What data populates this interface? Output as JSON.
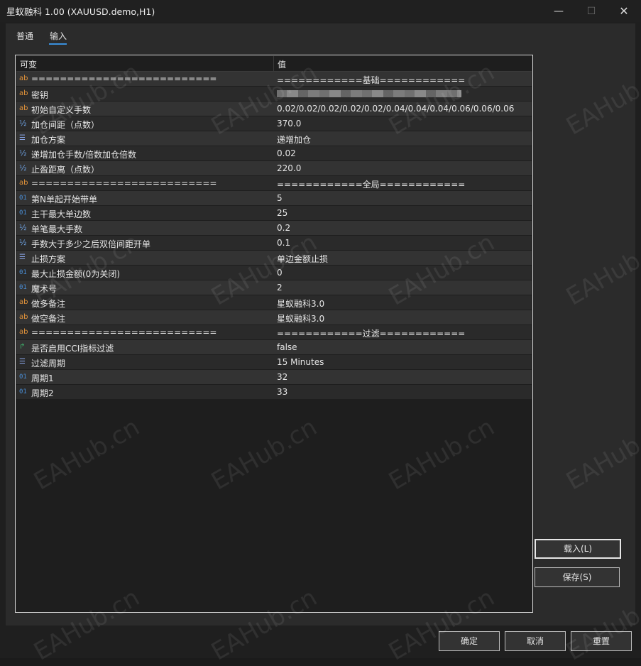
{
  "window": {
    "title": "星蚁融科 1.00 (XAUUSD.demo,H1)",
    "min_glyph": "—",
    "max_glyph": "☐",
    "close_glyph": "✕"
  },
  "tabs": [
    "普通",
    "输入"
  ],
  "grid": {
    "header_variable": "可变",
    "header_value": "值",
    "rows": [
      {
        "icon": "ab",
        "name": "==========================",
        "value": "============基础============"
      },
      {
        "icon": "ab",
        "name": "密钥",
        "value": "",
        "redacted": true
      },
      {
        "icon": "ab",
        "name": "初始自定义手数",
        "value": "0.02/0.02/0.02/0.02/0.02/0.04/0.04/0.04/0.06/0.06/0.06"
      },
      {
        "icon": "½",
        "name": "加仓间距（点数）",
        "value": "370.0"
      },
      {
        "icon": "enum",
        "name": "加仓方案",
        "value": "递增加仓"
      },
      {
        "icon": "½",
        "name": "递增加仓手数/倍数加仓倍数",
        "value": "0.02"
      },
      {
        "icon": "½",
        "name": "止盈距离（点数）",
        "value": "220.0"
      },
      {
        "icon": "ab",
        "name": "==========================",
        "value": "============全局============"
      },
      {
        "icon": "01",
        "name": "第N单起开始带单",
        "value": "5"
      },
      {
        "icon": "01",
        "name": "主干最大单边数",
        "value": "25"
      },
      {
        "icon": "½",
        "name": "单笔最大手数",
        "value": "0.2"
      },
      {
        "icon": "½",
        "name": "手数大于多少之后双倍间距开单",
        "value": "0.1"
      },
      {
        "icon": "enum",
        "name": "止损方案",
        "value": "单边金额止损"
      },
      {
        "icon": "01",
        "name": "最大止损金额(0为关闭)",
        "value": "0"
      },
      {
        "icon": "01",
        "name": "魔术号",
        "value": "2"
      },
      {
        "icon": "ab",
        "name": "做多备注",
        "value": "星蚁融科3.0"
      },
      {
        "icon": "ab",
        "name": "做空备注",
        "value": "星蚁融科3.0"
      },
      {
        "icon": "ab",
        "name": "==========================",
        "value": "============过滤============"
      },
      {
        "icon": "bool",
        "name": "是否启用CCI指标过滤",
        "value": "false"
      },
      {
        "icon": "enum",
        "name": "过滤周期",
        "value": "15 Minutes"
      },
      {
        "icon": "01",
        "name": "周期1",
        "value": "32"
      },
      {
        "icon": "01",
        "name": "周期2",
        "value": "33"
      }
    ]
  },
  "buttons": {
    "load": "载入(L)",
    "save": "保存(S)",
    "ok": "确定",
    "cancel": "取消",
    "reset": "重置"
  },
  "watermark": "EAHub.cn"
}
